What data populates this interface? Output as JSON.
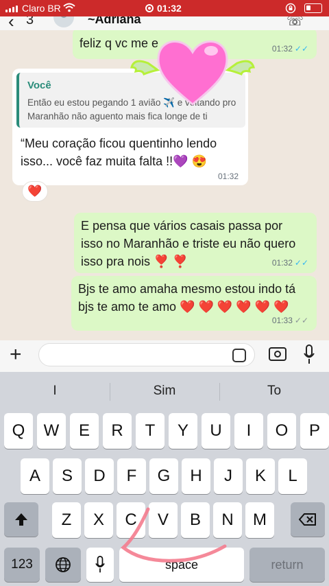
{
  "status_bar": {
    "carrier": "Claro BR",
    "time": "01:32"
  },
  "chat_header": {
    "back_icon": "chevron-left-icon",
    "unread_count": "3",
    "contact_name": "~Adriana"
  },
  "messages": [
    {
      "direction": "outgoing",
      "text": "feliz q vc me e",
      "time": "01:32",
      "status": "read"
    },
    {
      "direction": "incoming",
      "quote_author": "Você",
      "quote_text": "Então eu estou pegando 1 avião ✈️ e voltando pro Maranhão não aguento mais fica longe de ti",
      "text": "“Meu coração ficou quentinho lendo isso... você faz muita falta !!💜 😍",
      "time": "01:32",
      "reaction": "❤️"
    },
    {
      "direction": "outgoing",
      "text": "E pensa que vários casais passa por isso no Maranhão e triste eu não quero isso pra nois ❣️ ❣️",
      "time": "01:32",
      "status": "read"
    },
    {
      "direction": "outgoing",
      "text": "Bjs te amo amaha mesmo estou indo tá bjs te amo te amo ❤️ ❤️ ❤️ ❤️ ❤️ ❤️",
      "time": "01:33",
      "status": "delivered"
    }
  ],
  "composer": {
    "input_value": ""
  },
  "keyboard": {
    "suggestions": [
      "I",
      "Sim",
      "To"
    ],
    "row1": [
      "Q",
      "W",
      "E",
      "R",
      "T",
      "Y",
      "U",
      "I",
      "O",
      "P"
    ],
    "row2": [
      "A",
      "S",
      "D",
      "F",
      "G",
      "H",
      "J",
      "K",
      "L"
    ],
    "row3": [
      "Z",
      "X",
      "C",
      "V",
      "B",
      "N",
      "M"
    ],
    "numbers_label": "123",
    "space_label": "space",
    "return_label": "return"
  },
  "colors": {
    "status_bar": "#cc2a2a",
    "outgoing_bubble": "#dcf8c6",
    "incoming_bubble": "#ffffff",
    "chat_background": "#efe7de",
    "read_ticks": "#34b7f1",
    "quote_accent": "#2a8c7a",
    "sticker_heart": "#ff6fd1"
  }
}
